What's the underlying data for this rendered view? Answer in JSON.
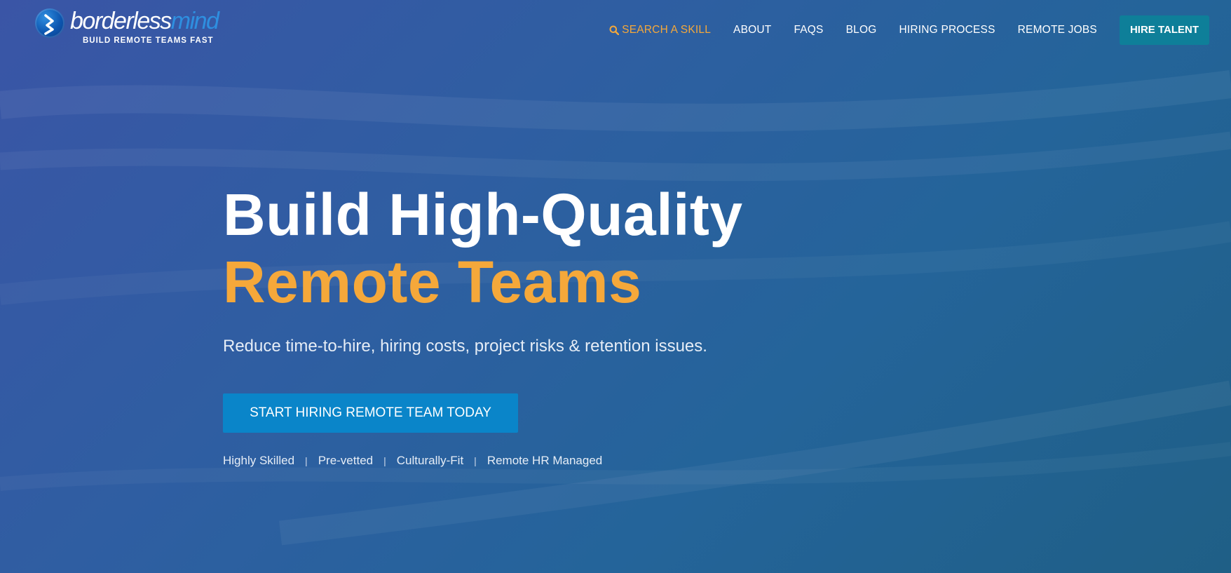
{
  "brand": {
    "name_part1": "borderless",
    "name_part2": "mind",
    "tagline": "BUILD REMOTE TEAMS FAST"
  },
  "nav": {
    "search_label": "SEARCH A SKILL",
    "items": [
      "ABOUT",
      "FAQS",
      "BLOG",
      "HIRING PROCESS",
      "REMOTE JOBS"
    ],
    "hire_button": "HIRE TALENT"
  },
  "hero": {
    "title_line1": "Build High-Quality",
    "title_line2": "Remote Teams",
    "subtitle": "Reduce time-to-hire, hiring costs, project risks & retention issues.",
    "cta_label": "START HIRING REMOTE TEAM TODAY",
    "features": [
      "Highly Skilled",
      "Pre-vetted",
      "Culturally-Fit",
      "Remote HR Managed"
    ],
    "separator": "|"
  },
  "colors": {
    "accent_orange": "#f5a83a",
    "cta_blue": "#0a85c9",
    "hire_teal": "#0e7f99",
    "logo_blue": "#2e8fe0"
  },
  "icons": {
    "search": "search-icon",
    "logo": "logo-mark-icon"
  }
}
